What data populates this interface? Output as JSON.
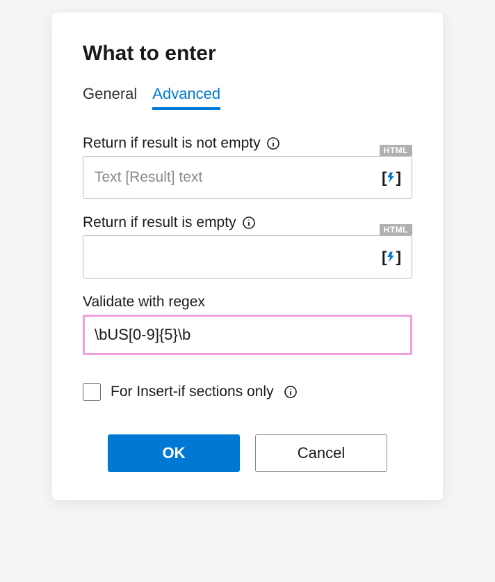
{
  "dialog": {
    "title": "What to enter",
    "tabs": {
      "general": "General",
      "advanced": "Advanced"
    },
    "fields": {
      "return_not_empty": {
        "label": "Return if result is not empty",
        "placeholder": "Text [Result] text",
        "badge": "HTML",
        "value": ""
      },
      "return_empty": {
        "label": "Return if result is empty",
        "placeholder": "",
        "badge": "HTML",
        "value": ""
      },
      "regex": {
        "label": "Validate with regex",
        "value": "\\bUS[0-9]{5}\\b"
      },
      "insert_if": {
        "label": "For Insert-if sections only",
        "checked": false
      }
    },
    "buttons": {
      "ok": "OK",
      "cancel": "Cancel"
    }
  }
}
